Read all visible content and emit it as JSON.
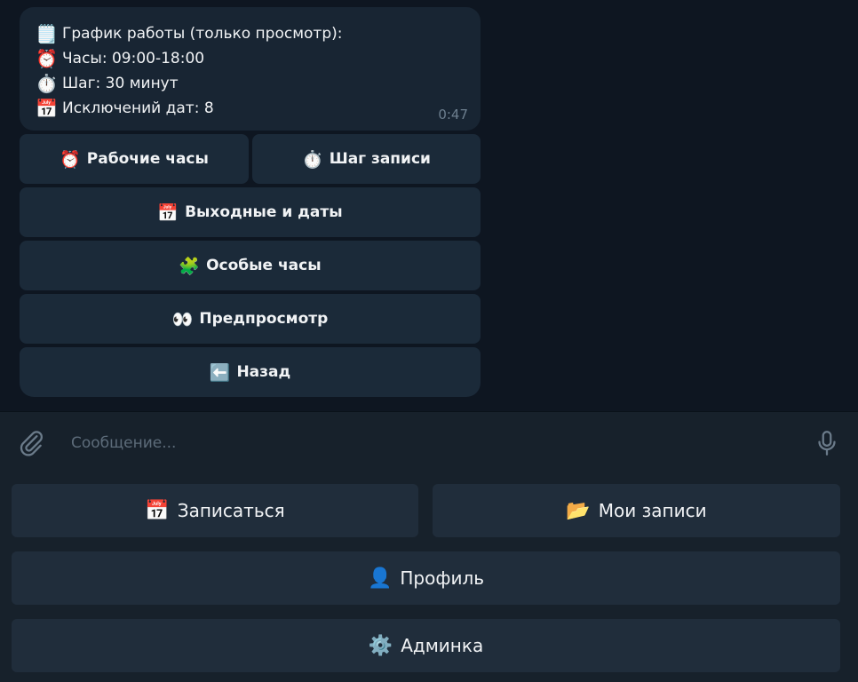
{
  "message": {
    "lines": [
      {
        "icon": "🗒️",
        "icon_name": "notepad-icon",
        "text": "График работы (только просмотр):"
      },
      {
        "icon": "⏰",
        "icon_name": "alarm-clock-icon",
        "text": "Часы: 09:00-18:00"
      },
      {
        "icon": "⏱️",
        "icon_name": "stopwatch-icon",
        "text": "Шаг: 30 минут"
      },
      {
        "icon": "📅",
        "icon_name": "calendar-icon",
        "text": "Исключений дат: 8"
      }
    ],
    "time": "0:47"
  },
  "inline_keyboard": [
    {
      "icon": "⏰",
      "icon_name": "alarm-clock-icon",
      "label": "Рабочие часы"
    },
    {
      "icon": "⏱️",
      "icon_name": "stopwatch-icon",
      "label": "Шаг записи"
    },
    {
      "icon": "📅",
      "icon_name": "calendar-icon",
      "label": "Выходные и даты"
    },
    {
      "icon": "🧩",
      "icon_name": "puzzle-icon",
      "label": "Особые часы"
    },
    {
      "icon": "👀",
      "icon_name": "eyes-icon",
      "label": "Предпросмотр"
    },
    {
      "icon": "⬅️",
      "icon_name": "arrow-left-icon",
      "label": "Назад"
    }
  ],
  "composer": {
    "placeholder": "Сообщение..."
  },
  "reply_keyboard": [
    {
      "icon": "📅",
      "icon_name": "calendar-icon",
      "label": "Записаться"
    },
    {
      "icon": "📂",
      "icon_name": "folder-icon",
      "label": "Мои записи"
    },
    {
      "icon": "👤",
      "icon_name": "user-icon",
      "label": "Профиль"
    },
    {
      "icon": "⚙️",
      "icon_name": "gear-icon",
      "label": "Админка"
    }
  ],
  "colors": {
    "chat_background": "#0e1621",
    "bubble": "#182533",
    "inline_button": "#1b2a39",
    "panel": "#17212b",
    "reply_button": "#202d3b"
  }
}
